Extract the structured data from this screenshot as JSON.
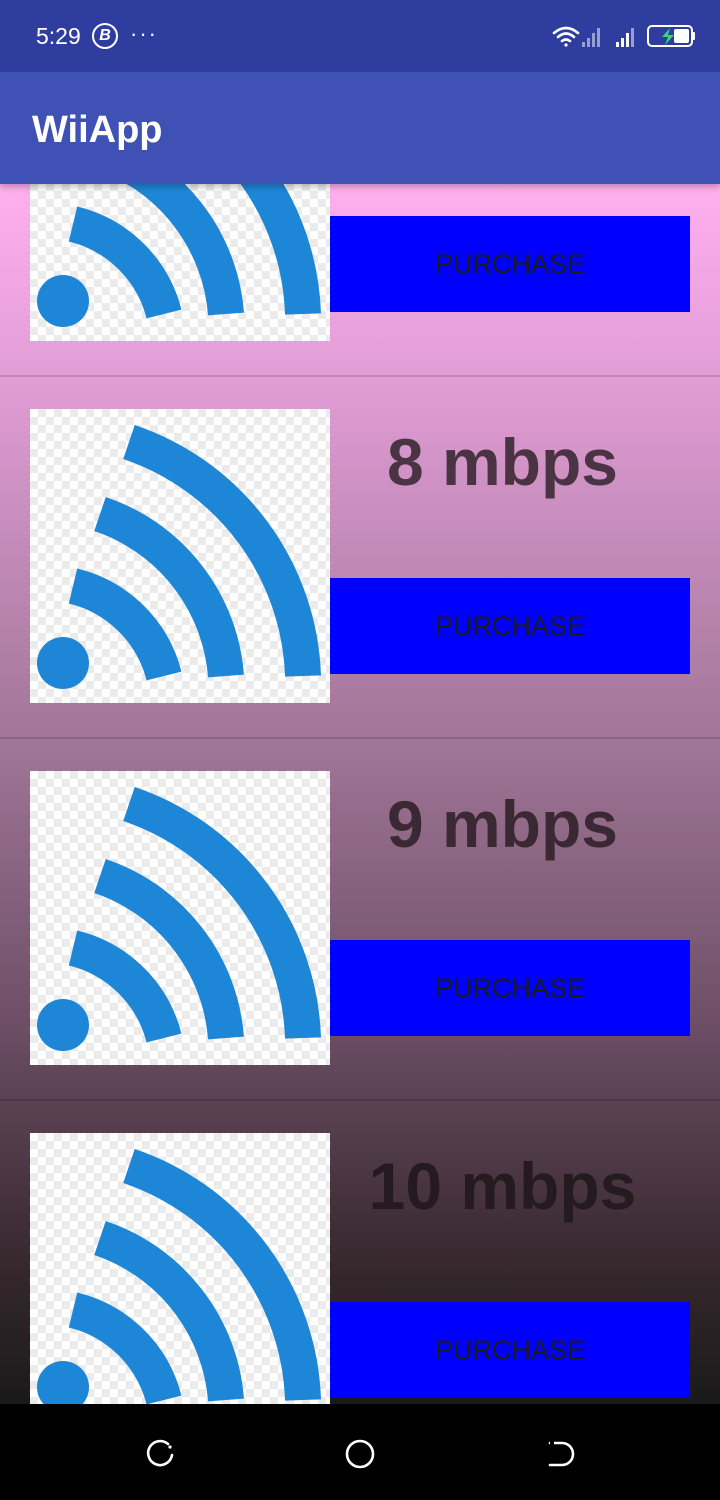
{
  "status_bar": {
    "time": "5:29",
    "b_badge": "B",
    "more_dots": "···",
    "icons": [
      "wifi-icon",
      "signal-icon",
      "signal-icon",
      "battery-charging-icon"
    ]
  },
  "app_bar": {
    "title": "WiiApp"
  },
  "plans": [
    {
      "speed": "",
      "button_label": "PURCHASE",
      "icon": "wifi-icon"
    },
    {
      "speed": "8 mbps",
      "button_label": "PURCHASE",
      "icon": "wifi-icon"
    },
    {
      "speed": "9 mbps",
      "button_label": "PURCHASE",
      "icon": "wifi-icon"
    },
    {
      "speed": "10 mbps",
      "button_label": "PURCHASE",
      "icon": "wifi-icon"
    }
  ],
  "nav_bar": {
    "icons": [
      "recents-icon",
      "home-icon",
      "back-icon"
    ]
  },
  "colors": {
    "status_bar": "#2f3e9e",
    "app_bar": "#3f51b5",
    "purchase_button": "#0000ff",
    "wifi_icon": "#1e86d6",
    "gradient_top": "#ffafee",
    "gradient_bottom": "#1a1a1a"
  }
}
